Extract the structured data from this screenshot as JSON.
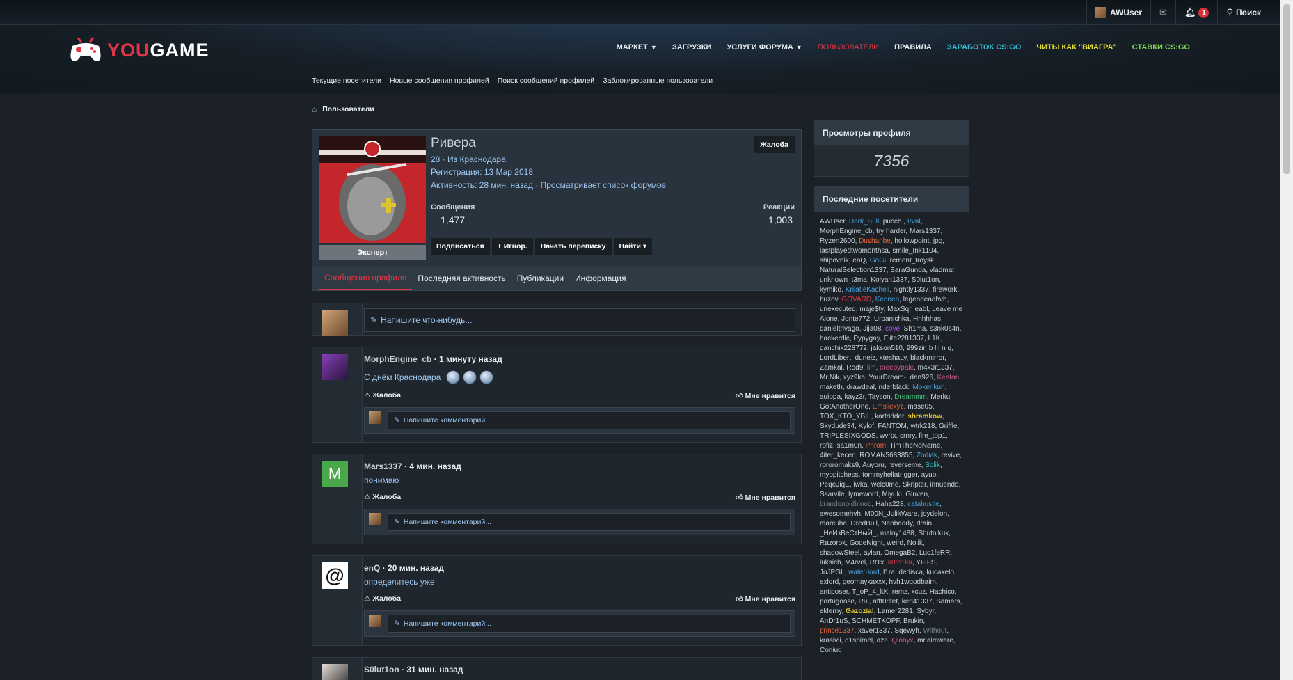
{
  "topbar": {
    "username": "AWUser",
    "notif_count": "1",
    "search_label": "Поиск"
  },
  "logo": {
    "you": "YOU",
    "game": "GAME"
  },
  "nav": {
    "market": "МАРКЕТ",
    "downloads": "ЗАГРУЗКИ",
    "services": "УСЛУГИ ФОРУМА",
    "users": "ПОЛЬЗОВАТЕЛИ",
    "rules": "ПРАВИЛА",
    "earn": "ЗАРАБОТОК CS:GO",
    "cheats": "ЧИТЫ КАК \"ВИАГРА\"",
    "bets": "СТАВКИ CS:GO",
    "colors": {
      "users": "#e03645",
      "earn": "#35c3d8",
      "cheats": "#e8e234",
      "bets": "#7ed957"
    }
  },
  "subnav": [
    "Текущие посетители",
    "Новые сообщения профилей",
    "Поиск сообщений профилей",
    "Заблокированные пользователи"
  ],
  "breadcrumb": {
    "label": "Пользователи"
  },
  "profile": {
    "name": "Ривера",
    "line1": "28 · Из Краснодара",
    "line2": "Регистрация: 13 Мар 2018",
    "line3": "Активность: 28 мин. назад · Просматривает список форумов",
    "rank": "Эксперт",
    "complaint": "Жалоба",
    "messages_label": "Сообщения",
    "messages_value": "1,477",
    "reactions_label": "Реакции",
    "reactions_value": "1,003",
    "actions": [
      "Подписаться",
      "+ Игнор.",
      "Начать переписку",
      "Найти ▾"
    ],
    "tabs": [
      "Сообщения профиля",
      "Последняя активность",
      "Публикации",
      "Информация"
    ]
  },
  "write": {
    "placeholder": "Напишите что-нибудь..."
  },
  "posts": [
    {
      "user": "MorphEngine_cb",
      "time": "1 минуту назад",
      "text": "С днём Краснодара"
    },
    {
      "user": "Mars1337",
      "time": "4 мин. назад",
      "text": "понимаю",
      "initial": "M"
    },
    {
      "user": "enQ",
      "time": "20 мин. назад",
      "text": "определитесь уже"
    },
    {
      "user": "S0lut1on",
      "time": "31 мин. назад"
    }
  ],
  "post_actions": {
    "complaint": "Жалоба",
    "like": "Мне нравится",
    "comment": "Напишите комментарий..."
  },
  "sidebar": {
    "views_title": "Просмотры профиля",
    "views_value": "7356",
    "visitors_title": "Последние посетители"
  },
  "visitors": [
    [
      "AWUser",
      ""
    ],
    [
      "Dark_Bull",
      "v-blue"
    ],
    [
      "pucch.",
      ""
    ],
    [
      "Irval",
      "v-blue"
    ],
    [
      "MorphEngine_cb",
      ""
    ],
    [
      "try harder",
      ""
    ],
    [
      "Mars1337",
      ""
    ],
    [
      "Ryzen2600",
      ""
    ],
    [
      "Dushanbe",
      "v-orange"
    ],
    [
      "hollowpoint",
      ""
    ],
    [
      "jpg",
      ""
    ],
    [
      "lastplayedtwomonthsa",
      ""
    ],
    [
      "smile_Ink1104",
      ""
    ],
    [
      "shipovnik",
      ""
    ],
    [
      "enQ",
      ""
    ],
    [
      "GoGi",
      "v-blue"
    ],
    [
      "remont_troysk",
      ""
    ],
    [
      "NaturalSelection1337",
      ""
    ],
    [
      "BaraGunda",
      ""
    ],
    [
      "vladmar",
      ""
    ],
    [
      "unknown_t3ma",
      ""
    ],
    [
      "Kolyan1337",
      ""
    ],
    [
      "S0lut1on",
      ""
    ],
    [
      "kymiko",
      ""
    ],
    [
      "KrilatieKacheli",
      "v-blue"
    ],
    [
      "nightly1337",
      ""
    ],
    [
      "firework",
      ""
    ],
    [
      "buzov",
      ""
    ],
    [
      "GOVARD",
      "v-red"
    ],
    [
      "Kennen",
      "v-blue"
    ],
    [
      "legendeadhvh",
      ""
    ],
    [
      "unexecuted",
      ""
    ],
    [
      "maje$ty",
      ""
    ],
    [
      "MaxSqr",
      ""
    ],
    [
      "eabl",
      ""
    ],
    [
      "Leave me Alone",
      ""
    ],
    [
      "Jonte772",
      ""
    ],
    [
      "Urbanichka",
      ""
    ],
    [
      "Hhhhhas",
      ""
    ],
    [
      "danieltrivago",
      ""
    ],
    [
      "Jija08",
      ""
    ],
    [
      "sove",
      "v-purple"
    ],
    [
      "Sh1ma",
      ""
    ],
    [
      "s3nk0s4n",
      ""
    ],
    [
      "hackerdlc",
      ""
    ],
    [
      "Pypygay",
      ""
    ],
    [
      "Elite2281337",
      ""
    ],
    [
      "L1K",
      ""
    ],
    [
      "danchik228772",
      ""
    ],
    [
      "jakson510",
      ""
    ],
    [
      "999zir",
      ""
    ],
    [
      "b l i n q",
      ""
    ],
    [
      "LordLibert",
      ""
    ],
    [
      "duneiz",
      ""
    ],
    [
      "xteshaLy",
      ""
    ],
    [
      "blackmirror",
      ""
    ],
    [
      "Zamkal",
      ""
    ],
    [
      "Rod9",
      ""
    ],
    [
      "iim",
      "v-gray"
    ],
    [
      "creepypale",
      "v-pink"
    ],
    [
      "m4x3r1337",
      ""
    ],
    [
      "Mr.Nik",
      ""
    ],
    [
      "xyz9ka",
      ""
    ],
    [
      "YourDream-",
      ""
    ],
    [
      "dan926",
      ""
    ],
    [
      "Keaton",
      "v-pink"
    ],
    [
      "maketh",
      ""
    ],
    [
      "drawdeal",
      ""
    ],
    [
      "riderblack",
      ""
    ],
    [
      "Mokerikun",
      "v-blue"
    ],
    [
      "auiopa",
      ""
    ],
    [
      "kayz3r",
      ""
    ],
    [
      "Tayson",
      ""
    ],
    [
      "Dreammm",
      "v-green"
    ],
    [
      "Merku",
      ""
    ],
    [
      "GotAnotherOne",
      ""
    ],
    [
      "Emsliexyz",
      "v-orange"
    ],
    [
      "mase05",
      ""
    ],
    [
      "TOX_KTO_YBIL",
      ""
    ],
    [
      "kartridder",
      ""
    ],
    [
      "shramkow",
      "v-yellow"
    ],
    [
      "Skydude34",
      ""
    ],
    [
      "Kylof",
      ""
    ],
    [
      "FANTOM",
      ""
    ],
    [
      "wtrk218",
      ""
    ],
    [
      "Griffle",
      ""
    ],
    [
      "TRIPLESIXGODS",
      ""
    ],
    [
      "wvrtx",
      ""
    ],
    [
      "crnry",
      ""
    ],
    [
      "fire_top1",
      ""
    ],
    [
      "rofiz",
      ""
    ],
    [
      "sa1m0n",
      ""
    ],
    [
      "Phrom",
      "v-orange"
    ],
    [
      "TimTheNoName",
      ""
    ],
    [
      "4iter_kecen",
      ""
    ],
    [
      "ROMAN5683855",
      ""
    ],
    [
      "Zodiak",
      "v-blue"
    ],
    [
      "revive",
      ""
    ],
    [
      "rororomaks9",
      ""
    ],
    [
      "Auyoru",
      ""
    ],
    [
      "reverseme",
      ""
    ],
    [
      "Solik",
      "v-teal"
    ],
    [
      "myppitchess",
      ""
    ],
    [
      "tommyhellatrigger",
      ""
    ],
    [
      "ayuo",
      ""
    ],
    [
      "PeqeJiqE",
      ""
    ],
    [
      "iwka",
      ""
    ],
    [
      "welc0me",
      ""
    ],
    [
      "Skripter",
      ""
    ],
    [
      "innuendo",
      ""
    ],
    [
      "Ssarvile",
      ""
    ],
    [
      "lymeword",
      ""
    ],
    [
      "Miyuki",
      ""
    ],
    [
      "Gluven",
      ""
    ],
    [
      "brandonoldblood",
      "v-gray"
    ],
    [
      "Haha228",
      ""
    ],
    [
      "catahustle",
      "v-blue"
    ],
    [
      "awesomehvh",
      ""
    ],
    [
      "M00N_JulikWare",
      ""
    ],
    [
      "joydelon",
      ""
    ],
    [
      "marcuha",
      ""
    ],
    [
      "DredBull",
      ""
    ],
    [
      "Neobaddy",
      ""
    ],
    [
      "drain",
      ""
    ],
    [
      "_НеИзВеСтНыЙ_",
      ""
    ],
    [
      "maloy1488",
      ""
    ],
    [
      "Shutnikuk",
      ""
    ],
    [
      "Razorok",
      ""
    ],
    [
      "GodeNight",
      ""
    ],
    [
      "weird",
      ""
    ],
    [
      "Nolik",
      ""
    ],
    [
      "shadowSteel",
      ""
    ],
    [
      "aylan",
      ""
    ],
    [
      "OmegaB2",
      ""
    ],
    [
      "Luc1feRR",
      ""
    ],
    [
      "luksich",
      ""
    ],
    [
      "M4rvel",
      ""
    ],
    [
      "Rt1x",
      ""
    ],
    [
      "k0te1ka",
      "v-red"
    ],
    [
      "YFIFS",
      ""
    ],
    [
      "JoJPGL",
      ""
    ],
    [
      "water-lord",
      "v-blue"
    ],
    [
      "l1ra",
      ""
    ],
    [
      "dedisca",
      ""
    ],
    [
      "kucakelo",
      ""
    ],
    [
      "exlord",
      ""
    ],
    [
      "geomaykaxxx",
      ""
    ],
    [
      "hvh1wgodbaim",
      ""
    ],
    [
      "antiposer",
      ""
    ],
    [
      "T_oP_4_kK",
      ""
    ],
    [
      "remz",
      ""
    ],
    [
      "xcuz",
      ""
    ],
    [
      "Hachico",
      ""
    ],
    [
      "portugoose",
      ""
    ],
    [
      "Rui",
      ""
    ],
    [
      "afft0ritet",
      ""
    ],
    [
      "keri41337",
      ""
    ],
    [
      "Samars",
      ""
    ],
    [
      "eklerny",
      ""
    ],
    [
      "Gazozial",
      "v-yellow"
    ],
    [
      "Lamer2281",
      ""
    ],
    [
      "Sybyr",
      ""
    ],
    [
      "AnDr1uS",
      ""
    ],
    [
      "SCHMETKOPF",
      ""
    ],
    [
      "Brukin",
      ""
    ],
    [
      "prince1337",
      "v-orange"
    ],
    [
      "xaver1337",
      ""
    ],
    [
      "Sqewyh",
      ""
    ],
    [
      "Without",
      "v-gray"
    ],
    [
      "krasivii",
      ""
    ],
    [
      "d1spimel",
      ""
    ],
    [
      "aze",
      ""
    ],
    [
      "Qionyx",
      "v-pink"
    ],
    [
      "mr.aimware",
      ""
    ],
    [
      "Coniud",
      ""
    ]
  ]
}
